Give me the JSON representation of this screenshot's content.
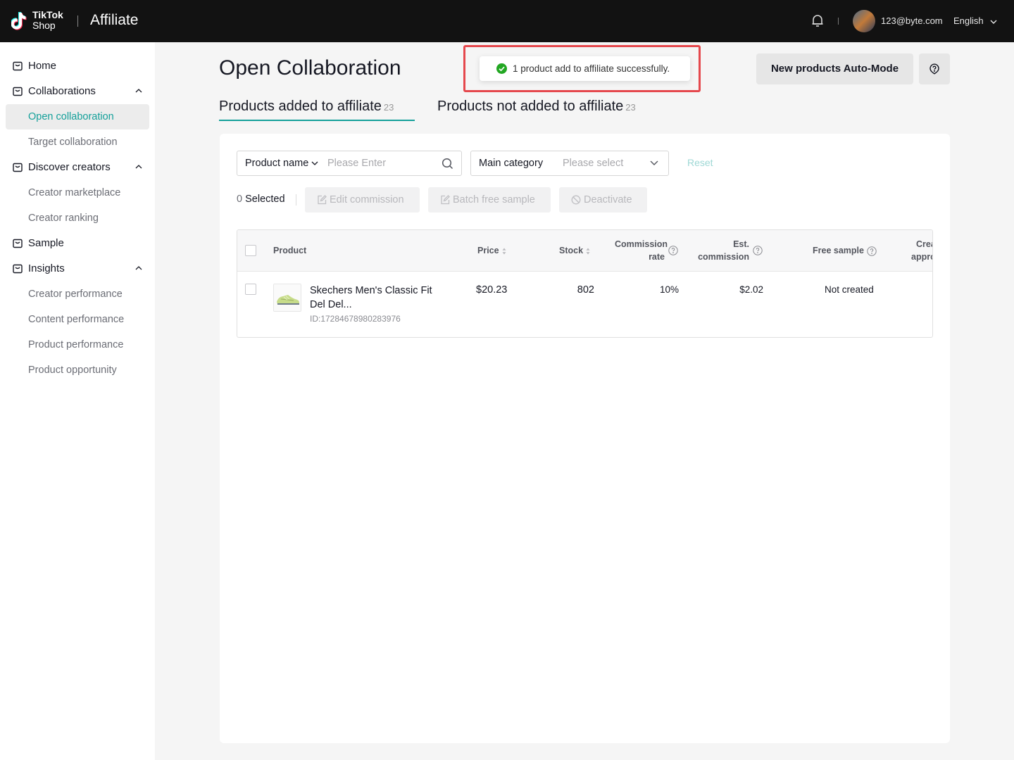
{
  "topbar": {
    "logo_line1": "TikTok",
    "logo_line2": "Shop",
    "title": "Affiliate",
    "email": "123@byte.com",
    "language": "English"
  },
  "sidebar": {
    "home": "Home",
    "collaborations": "Collaborations",
    "open_collaboration": "Open collaboration",
    "target_collaboration": "Target collaboration",
    "discover_creators": "Discover creators",
    "creator_marketplace": "Creator marketplace",
    "creator_ranking": "Creator ranking",
    "sample": "Sample",
    "insights": "Insights",
    "creator_performance": "Creator performance",
    "content_performance": "Content performance",
    "product_performance": "Product performance",
    "product_opportunity": "Product opportunity"
  },
  "page": {
    "title": "Open Collaboration",
    "toast": "1 product add to affiliate successfully.",
    "auto_mode_button": "New products Auto-Mode"
  },
  "tabs": [
    {
      "label": "Products added to affiliate",
      "count": "23"
    },
    {
      "label": "Products not added to affiliate",
      "count": "23"
    }
  ],
  "filters": {
    "product_name_label": "Product name",
    "product_name_placeholder": "Please Enter",
    "category_label": "Main category",
    "category_placeholder": "Please select",
    "reset": "Reset"
  },
  "actions": {
    "selected_count": "0",
    "selected_label": "Selected",
    "edit_commission": "Edit commission",
    "batch_free_sample": "Batch free sample",
    "deactivate": "Deactivate"
  },
  "table": {
    "headers": {
      "product": "Product",
      "price": "Price",
      "stock": "Stock",
      "commission_l1": "Commission",
      "commission_l2": "rate",
      "est_l1": "Est.",
      "est_l2": "commission",
      "free_sample": "Free sample",
      "creator_l1": "Crea",
      "creator_l2": "appro"
    },
    "rows": [
      {
        "name": "Skechers Men's Classic Fit Del Del...",
        "id": "ID:17284678980283976",
        "price": "$20.23",
        "stock": "802",
        "commission_rate": "10%",
        "est_commission": "$2.02",
        "free_sample": "Not created"
      }
    ]
  }
}
